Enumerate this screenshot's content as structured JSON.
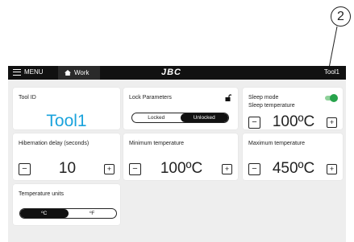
{
  "callout": "2",
  "topbar": {
    "menu_label": "MENU",
    "work_label": "Work",
    "logo": "JBC",
    "tool_label": "Tool1"
  },
  "tool_id": {
    "title": "Tool ID",
    "value": "Tool1"
  },
  "lock": {
    "title": "Lock Parameters",
    "options": [
      "Locked",
      "Unlocked"
    ],
    "selected": "Unlocked"
  },
  "sleep": {
    "title": "Sleep mode",
    "subtitle": "Sleep temperature",
    "enabled": true,
    "value": "100ºC"
  },
  "hibernation": {
    "title": "Hibernation delay (seconds)",
    "value": "10"
  },
  "min_temp": {
    "title": "Minimum temperature",
    "value": "100ºC"
  },
  "max_temp": {
    "title": "Maximum temperature",
    "value": "450ºC"
  },
  "units": {
    "title": "Temperature units",
    "options": [
      "ºC",
      "ºF"
    ],
    "selected": "ºC"
  },
  "buttons": {
    "minus": "−",
    "plus": "+"
  },
  "colors": {
    "accent": "#1aa3dc",
    "toggle_on": "#27a34b",
    "topbar": "#111111",
    "background": "#eeeeee"
  }
}
